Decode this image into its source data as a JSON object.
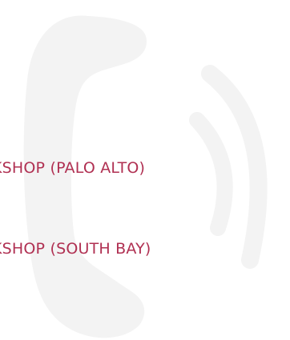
{
  "colors": {
    "link": "#b03052",
    "icon_fill": "#f3f3f3",
    "background": "#ffffff"
  },
  "background_icon": "phone-ringing-icon",
  "links": [
    {
      "label": "KSHOP (PALO ALTO)"
    },
    {
      "label": "KSHOP (SOUTH BAY)"
    }
  ]
}
